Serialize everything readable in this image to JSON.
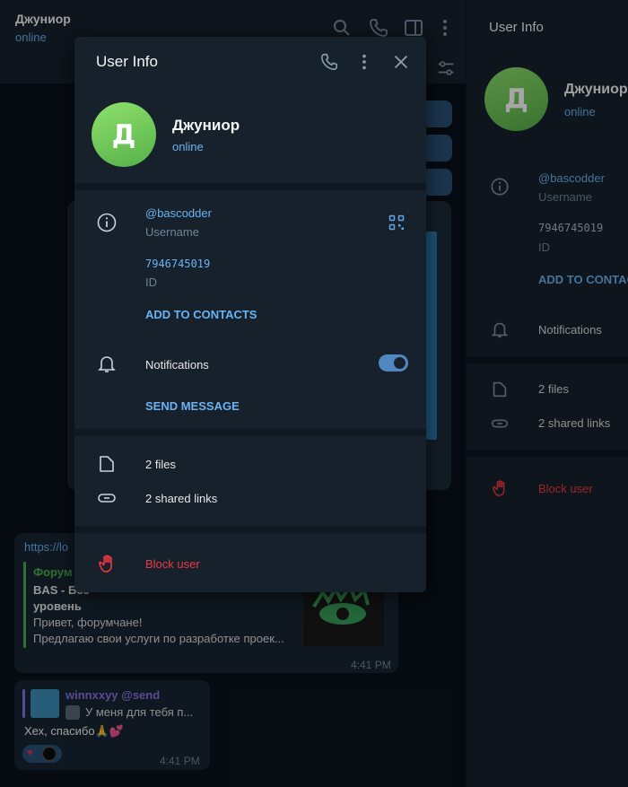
{
  "chat": {
    "title": "Джуниор",
    "status": "online",
    "link_preview_url": "https://lo",
    "forum_title": "Форум",
    "forum_heading_line1": "BAS - Бес",
    "forum_heading_line2": "уровень",
    "forum_greeting": "Привет, форумчане!",
    "forum_snippet": "Предлагаю свои услуги по разработке проек...",
    "time_1": "4:41 PM",
    "reply_name": "winnxxyy @send",
    "reply_text": "У меня для тебя п...",
    "message_text": "Хех, спасибо🙏💕",
    "time_2": "4:41 PM"
  },
  "right_panel": {
    "header": "User Info",
    "name": "Джуниор",
    "status": "online",
    "avatar_letter": "Д",
    "username": "@bascodder",
    "username_caption": "Username",
    "id": "7946745019",
    "id_caption": "ID",
    "add_contacts": "ADD TO CONTACTS",
    "notifications": "Notifications",
    "files": "2 files",
    "shared_links": "2 shared links",
    "block": "Block user"
  },
  "modal": {
    "title": "User Info",
    "avatar_letter": "Д",
    "name": "Джуниор",
    "status": "online",
    "username": "@bascodder",
    "username_caption": "Username",
    "id": "7946745019",
    "id_caption": "ID",
    "add_contacts": "ADD TO CONTACTS",
    "notifications": "Notifications",
    "notifications_on": true,
    "send_message": "SEND MESSAGE",
    "files": "2 files",
    "shared_links": "2 shared links",
    "block": "Block user"
  },
  "colors": {
    "accent": "#6ab3f3",
    "danger": "#ec3942",
    "avatar": "#6cc655"
  },
  "icons": [
    "search-icon",
    "phone-icon",
    "sidebar-icon",
    "more-icon",
    "close-icon",
    "info-icon",
    "qr-code-icon",
    "bell-icon",
    "file-icon",
    "link-icon",
    "hand-stop-icon",
    "filter-icon"
  ]
}
